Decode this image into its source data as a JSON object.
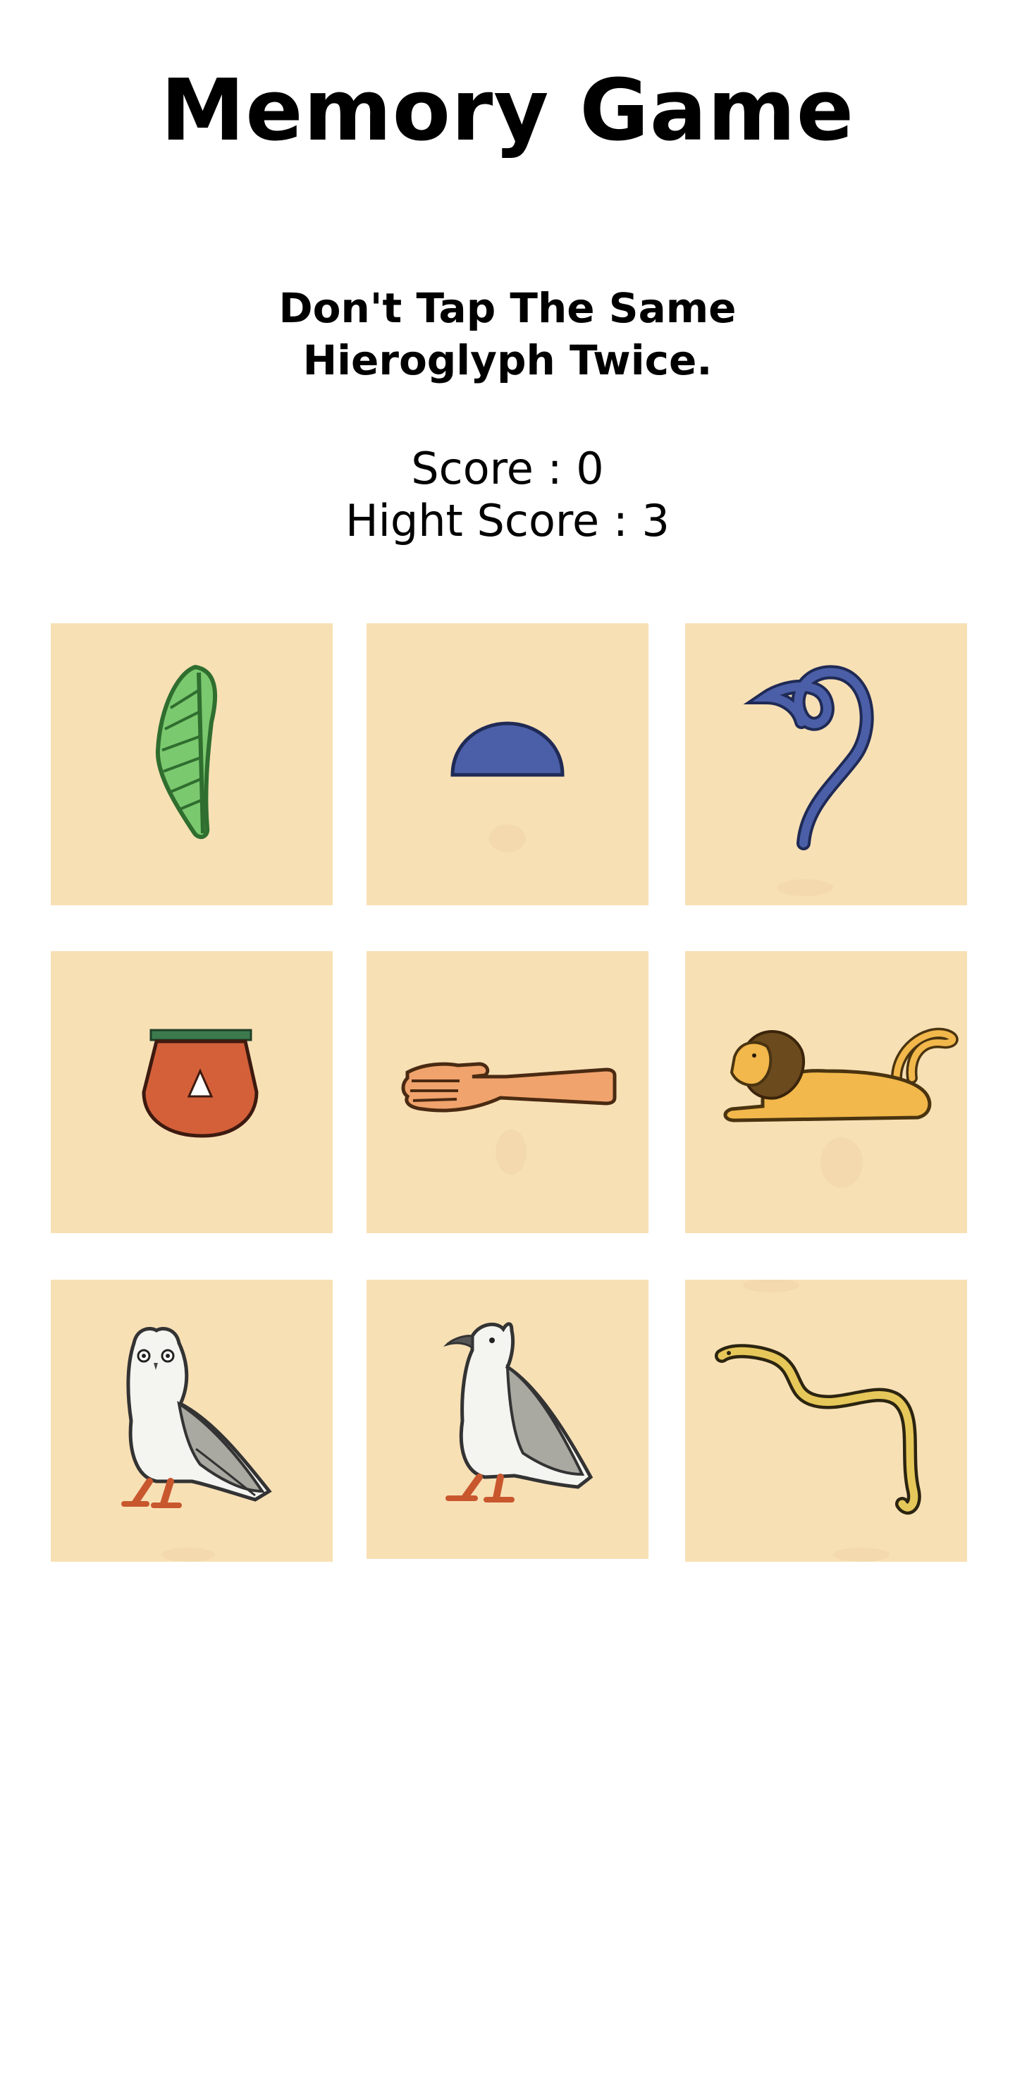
{
  "header": {
    "title": "Memory Game"
  },
  "instruction": {
    "line1": "Don't Tap The Same",
    "line2": "Hieroglyph Twice."
  },
  "scores": {
    "score_label": "Score : 0",
    "high_score_label": "Hight Score : 3"
  },
  "board": {
    "tile_color": "#f8e0b5",
    "tiles": [
      {
        "icon": "reed-leaf-icon"
      },
      {
        "icon": "bread-loaf-icon"
      },
      {
        "icon": "twisted-flax-icon"
      },
      {
        "icon": "basket-handle-icon"
      },
      {
        "icon": "forearm-hand-icon"
      },
      {
        "icon": "recumbent-lion-icon"
      },
      {
        "icon": "owl-icon"
      },
      {
        "icon": "vulture-icon"
      },
      {
        "icon": "cobra-snake-icon"
      }
    ]
  }
}
